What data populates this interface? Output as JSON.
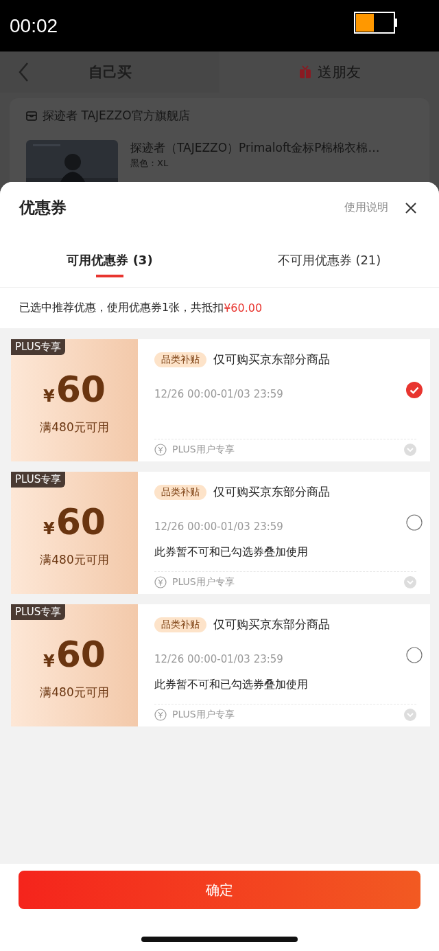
{
  "status_bar": {
    "time": "00:02"
  },
  "nav": {
    "tabs": [
      {
        "label": "自己买",
        "selected": true
      },
      {
        "label": "送朋友",
        "selected": false
      }
    ]
  },
  "store": {
    "name": "探迹者 TAJEZZO官方旗舰店"
  },
  "product": {
    "title": "探迹者（TAJEZZO）Primaloft金标P棉棉衣棉…",
    "spec": "黑色：XL"
  },
  "sheet": {
    "title": "优惠券",
    "help": "使用说明",
    "tabs": [
      {
        "label": "可用优惠券 (3)",
        "selected": true
      },
      {
        "label": "不可用优惠券 (21)",
        "selected": false
      }
    ],
    "summary": "已选中推荐优惠，使用优惠券1张，共抵扣",
    "summary_amount": "¥60.00"
  },
  "coupons": [
    {
      "badge": "PLUS专享",
      "currency": "¥",
      "amount": "60",
      "condition": "满480元可用",
      "tag": "品类补贴",
      "title": "仅可购买京东部分商品",
      "validity": "12/26 00:00-01/03 23:59",
      "footer": "PLUS用户专享",
      "selected": true
    },
    {
      "badge": "PLUS专享",
      "currency": "¥",
      "amount": "60",
      "condition": "满480元可用",
      "tag": "品类补贴",
      "title": "仅可购买京东部分商品",
      "validity": "12/26 00:00-01/03 23:59",
      "note": "此券暂不可和已勾选券叠加使用",
      "footer": "PLUS用户专享",
      "selected": false
    },
    {
      "badge": "PLUS专享",
      "currency": "¥",
      "amount": "60",
      "condition": "满480元可用",
      "tag": "品类补贴",
      "title": "仅可购买京东部分商品",
      "validity": "12/26 00:00-01/03 23:59",
      "note": "此券暂不可和已勾选券叠加使用",
      "footer": "PLUS用户专享",
      "selected": false
    }
  ],
  "confirm": "确定"
}
